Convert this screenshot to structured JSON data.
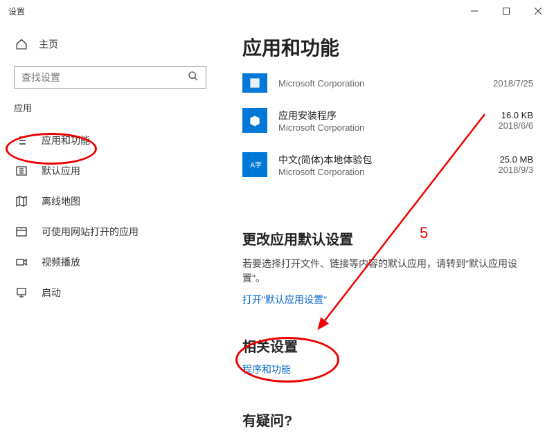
{
  "window": {
    "title": "设置"
  },
  "sidebar": {
    "home": "主页",
    "search_placeholder": "查找设置",
    "section": "应用",
    "items": [
      {
        "label": "应用和功能"
      },
      {
        "label": "默认应用"
      },
      {
        "label": "离线地图"
      },
      {
        "label": "可使用网站打开的应用"
      },
      {
        "label": "视频播放"
      },
      {
        "label": "启动"
      }
    ]
  },
  "content": {
    "title": "应用和功能",
    "apps": [
      {
        "name": "",
        "publisher": "Microsoft Corporation",
        "size": "",
        "date": "2018/7/25"
      },
      {
        "name": "应用安装程序",
        "publisher": "Microsoft Corporation",
        "size": "16.0 KB",
        "date": "2018/6/6"
      },
      {
        "name": "中文(简体)本地体验包",
        "publisher": "Microsoft Corporation",
        "size": "25.0 MB",
        "date": "2018/9/3"
      }
    ],
    "change_defaults": {
      "heading": "更改应用默认设置",
      "text": "若要选择打开文件、链接等内容的默认应用，请转到\"默认应用设置\"。",
      "link": "打开\"默认应用设置\""
    },
    "related": {
      "heading": "相关设置",
      "link": "程序和功能"
    },
    "question": {
      "heading": "有疑问?"
    }
  },
  "annotation": {
    "number": "5"
  }
}
